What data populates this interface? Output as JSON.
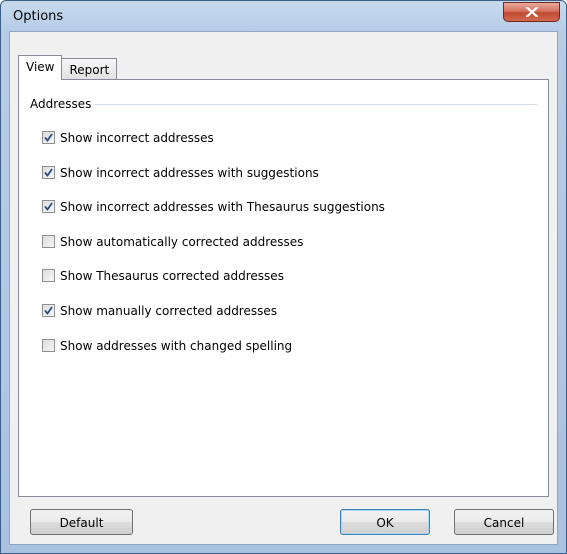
{
  "window": {
    "title": "Options"
  },
  "tabs": [
    {
      "label": "View",
      "active": true
    },
    {
      "label": "Report",
      "active": false
    }
  ],
  "group": {
    "label": "Addresses"
  },
  "options": [
    {
      "label": "Show incorrect addresses",
      "checked": true
    },
    {
      "label": "Show incorrect addresses with suggestions",
      "checked": true
    },
    {
      "label": "Show incorrect addresses with Thesaurus suggestions",
      "checked": true
    },
    {
      "label": "Show automatically corrected addresses",
      "checked": false
    },
    {
      "label": "Show Thesaurus corrected addresses",
      "checked": false
    },
    {
      "label": "Show manually corrected addresses",
      "checked": true
    },
    {
      "label": "Show addresses with changed spelling",
      "checked": false
    }
  ],
  "buttons": {
    "default_label": "Default",
    "ok_label": "OK",
    "cancel_label": "Cancel"
  },
  "colors": {
    "check_mark": "#2c4d87",
    "close_button": "#c24a33",
    "frame": "#b7cde6"
  }
}
